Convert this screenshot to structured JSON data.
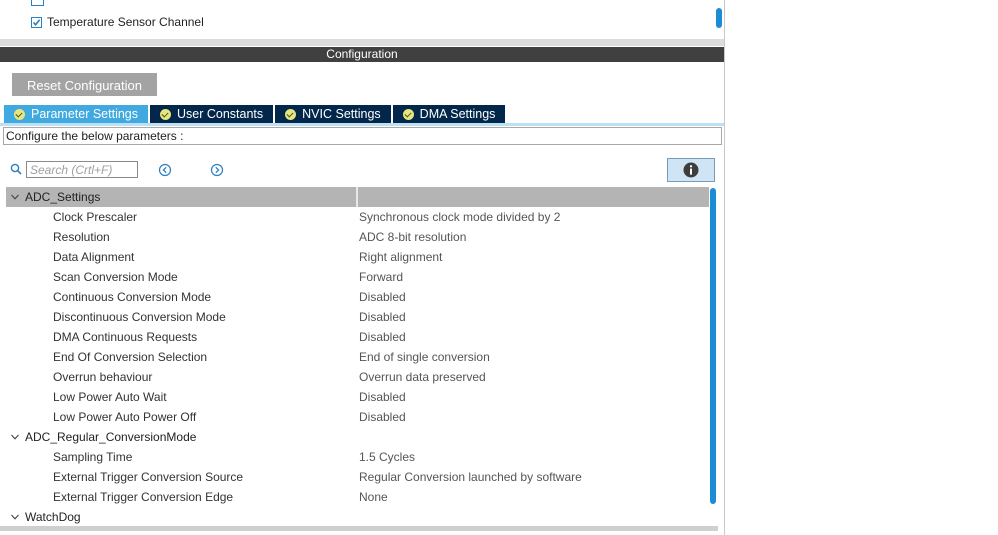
{
  "channels": {
    "items": [
      {
        "label": "Temperature Sensor Channel",
        "checked": true
      }
    ]
  },
  "config": {
    "header": "Configuration",
    "reset_label": "Reset Configuration",
    "tabs": [
      {
        "label": "Parameter Settings",
        "active": true
      },
      {
        "label": "User Constants",
        "active": false
      },
      {
        "label": "NVIC Settings",
        "active": false
      },
      {
        "label": "DMA Settings",
        "active": false
      }
    ],
    "description": "Configure the below parameters :",
    "search_placeholder": "Search (Crtl+F)"
  },
  "params": {
    "groups": [
      {
        "name": "ADC_Settings",
        "expanded": true,
        "items": [
          {
            "name": "Clock Prescaler",
            "value": "Synchronous clock mode divided by 2"
          },
          {
            "name": "Resolution",
            "value": "ADC 8-bit resolution"
          },
          {
            "name": "Data Alignment",
            "value": "Right alignment"
          },
          {
            "name": "Scan Conversion Mode",
            "value": "Forward"
          },
          {
            "name": "Continuous Conversion Mode",
            "value": "Disabled"
          },
          {
            "name": "Discontinuous Conversion Mode",
            "value": "Disabled"
          },
          {
            "name": "DMA Continuous Requests",
            "value": "Disabled"
          },
          {
            "name": "End Of Conversion Selection",
            "value": "End of single conversion"
          },
          {
            "name": "Overrun behaviour",
            "value": "Overrun data preserved"
          },
          {
            "name": "Low Power Auto Wait",
            "value": "Disabled"
          },
          {
            "name": "Low Power Auto Power Off",
            "value": "Disabled"
          }
        ]
      },
      {
        "name": "ADC_Regular_ConversionMode",
        "expanded": true,
        "items": [
          {
            "name": "Sampling Time",
            "value": "1.5 Cycles"
          },
          {
            "name": "External Trigger Conversion Source",
            "value": "Regular Conversion launched by software"
          },
          {
            "name": "External Trigger Conversion Edge",
            "value": "None"
          }
        ]
      },
      {
        "name": "WatchDog",
        "expanded": true,
        "items": []
      }
    ]
  },
  "colors": {
    "tab_active": "#3fa9e0",
    "tab_inactive": "#02274a",
    "header_bg": "#404040",
    "scrollbar": "#1c8cd6",
    "group_bg": "#b4b4b4"
  }
}
